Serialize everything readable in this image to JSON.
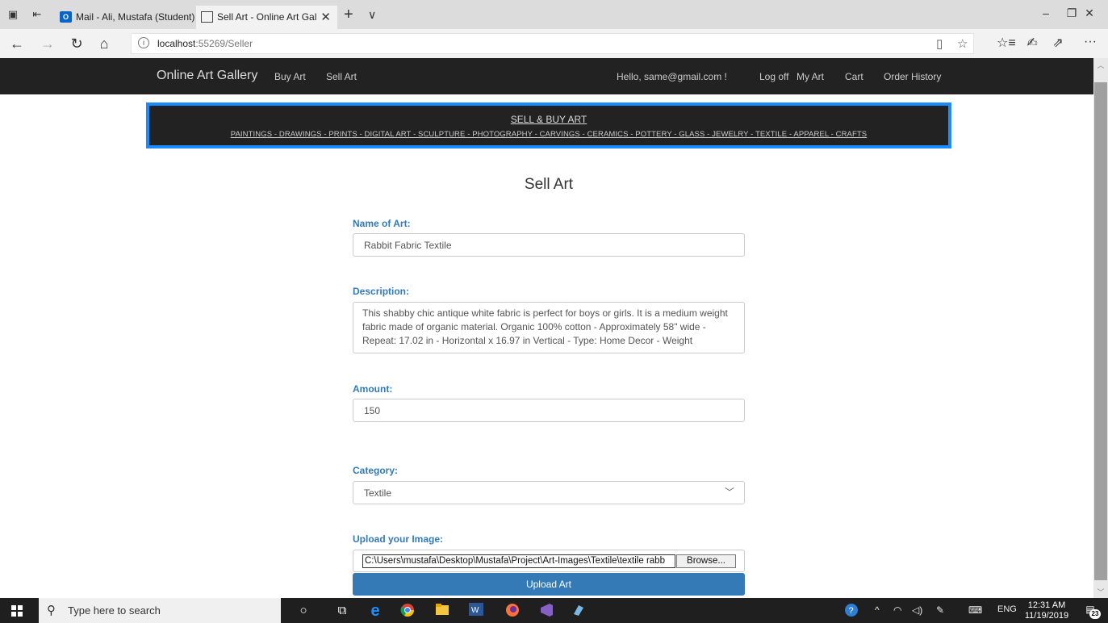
{
  "browser": {
    "tabs": [
      {
        "title": "Mail - Ali, Mustafa (Student)",
        "icon": "outlook-icon",
        "active": false
      },
      {
        "title": "Sell Art - Online Art Gal",
        "icon": "page-icon",
        "active": true
      }
    ],
    "new_tab_glyph": "+",
    "tab_list_glyph": "∨",
    "window_controls": {
      "minimize": "–",
      "restore": "❐",
      "close": "✕"
    },
    "address": {
      "host": "localhost",
      "path": ":55269/Seller"
    },
    "toolbar_glyphs": {
      "back": "←",
      "forward": "→",
      "refresh": "↻",
      "home": "⌂",
      "info": "i",
      "reading_view": "▯",
      "favorite": "☆",
      "favorites_list": "☆≡",
      "pen": "✍",
      "share": "⇗",
      "more": "···"
    }
  },
  "site": {
    "brand": "Online Art Gallery",
    "nav_left": [
      "Buy Art",
      "Sell Art"
    ],
    "greeting": "Hello, same@gmail.com !",
    "nav_right": [
      "Log off",
      "My Art",
      "Cart",
      "Order History"
    ]
  },
  "banner": {
    "title": "SELL & BUY ART",
    "categories": "PAINTINGS - DRAWINGS - PRINTS - DIGITAL ART - SCULPTURE - PHOTOGRAPHY - CARVINGS - CERAMICS - POTTERY - GLASS - JEWELRY - TEXTILE - APPAREL - CRAFTS"
  },
  "form": {
    "title": "Sell Art",
    "name_label": "Name of Art:",
    "name_value": "Rabbit Fabric Textile",
    "description_label": "Description:",
    "description_value": "This shabby chic antique white fabric is perfect for boys or girls. It is a medium weight fabric made of organic material. Organic 100% cotton - Approximately 58\" wide - Repeat: 17.02 in - Horizontal x 16.97 in Vertical - Type: Home Decor - Weight",
    "amount_label": "Amount:",
    "amount_value": "150",
    "category_label": "Category:",
    "category_value": "Textile",
    "image_label": "Upload your Image:",
    "file_path": "C:\\Users\\mustafa\\Desktop\\Mustafa\\Project\\Art-Images\\Textile\\textile rabb",
    "browse_label": "Browse...",
    "submit_label": "Upload Art"
  },
  "taskbar": {
    "search_placeholder": "Type here to search",
    "time": "12:31 AM",
    "date": "11/19/2019",
    "language": "ENG",
    "notification_count": "23"
  }
}
